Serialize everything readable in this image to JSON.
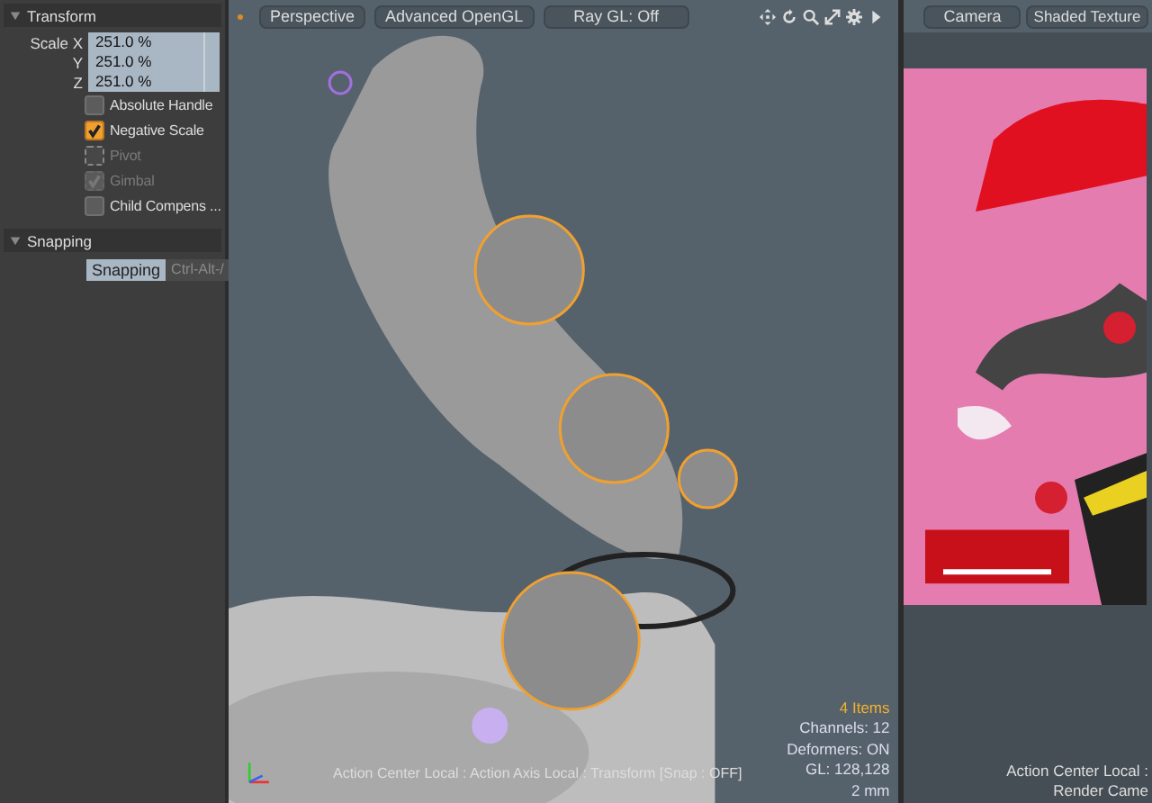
{
  "transform": {
    "title": "Transform",
    "expanded": true,
    "scale": [
      {
        "label": "Scale X",
        "value": "251.0 %"
      },
      {
        "label": "Y",
        "value": "251.0 %"
      },
      {
        "label": "Z",
        "value": "251.0 %"
      }
    ],
    "options": [
      {
        "label": "Absolute Handle",
        "checked": false,
        "disabled": false
      },
      {
        "label": "Negative Scale",
        "checked": true,
        "disabled": false
      },
      {
        "label": "Pivot",
        "checked": false,
        "disabled": true
      },
      {
        "label": "Gimbal",
        "checked": true,
        "disabled": true
      },
      {
        "label": "Child Compens ...",
        "checked": false,
        "disabled": false
      }
    ]
  },
  "snapping": {
    "title": "Snapping",
    "expanded": true,
    "button": "Snapping",
    "shortcut": "Ctrl-Alt-/"
  },
  "viewport": {
    "buttons": [
      "Perspective",
      "Advanced OpenGL",
      "Ray GL: Off"
    ],
    "status_line": "Action Center Local : Action Axis Local : Transform [Snap : OFF]",
    "info": [
      {
        "text": "4 Items",
        "kind": "highlight"
      },
      {
        "text": "Channels: 12",
        "kind": "plain"
      },
      {
        "text": "Deformers: ON",
        "kind": "plain"
      },
      {
        "text": "GL: 128,128",
        "kind": "plain"
      },
      {
        "text": "2 mm",
        "kind": "plain"
      }
    ]
  },
  "camera_view": {
    "buttons": [
      "Camera",
      "Shaded Texture"
    ],
    "status_lines": [
      "Action Center Local :",
      "Render Came"
    ]
  }
}
